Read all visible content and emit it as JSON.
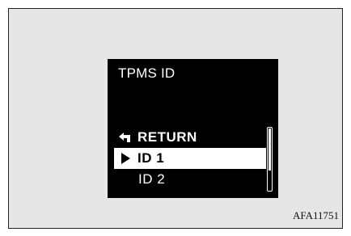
{
  "screen": {
    "title": "TPMS ID",
    "menu": [
      {
        "label": "RETURN",
        "icon": "return-arrow-icon",
        "selected": false
      },
      {
        "label": "ID 1",
        "icon": "play-triangle-icon",
        "selected": true
      },
      {
        "label": "ID 2",
        "icon": null,
        "selected": false
      }
    ]
  },
  "figure_code": "AFA11751",
  "colors": {
    "frame_bg": "#e6e6e6",
    "screen_bg": "#000000",
    "text": "#ffffff",
    "highlight": "#ffffff"
  }
}
